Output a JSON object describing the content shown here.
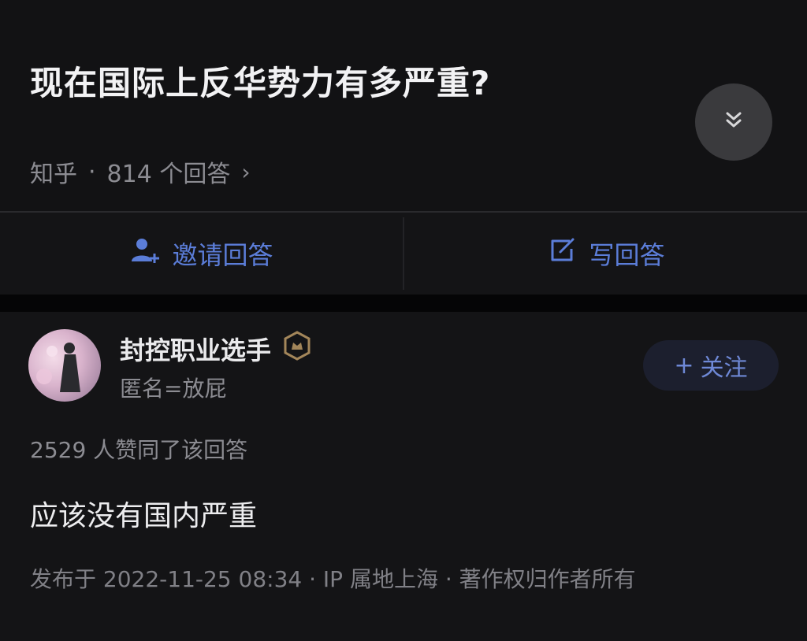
{
  "question": {
    "title": "现在国际上反华势力有多严重?",
    "source": "知乎",
    "separator": "·",
    "answer_count": "814 个回答",
    "chevron": "›"
  },
  "actions": {
    "invite_label": "邀请回答",
    "write_label": "写回答"
  },
  "answer": {
    "author_name": "封控职业选手",
    "author_bio": "匿名=放屁",
    "follow_label": "关注",
    "follow_prefix": "+",
    "likes_text": "2529 人赞同了该回答",
    "content": "应该没有国内严重",
    "publish_info": "发布于 2022-11-25 08:34 · IP 属地上海 · 著作权归作者所有"
  },
  "icons": {
    "collapse": "double-chevron-down-icon",
    "invite": "add-user-icon",
    "write": "edit-icon",
    "badge": "badge-icon"
  },
  "colors": {
    "accent_blue": "#5b7dd8",
    "background": "#121214",
    "muted_text": "#8c8c92"
  }
}
